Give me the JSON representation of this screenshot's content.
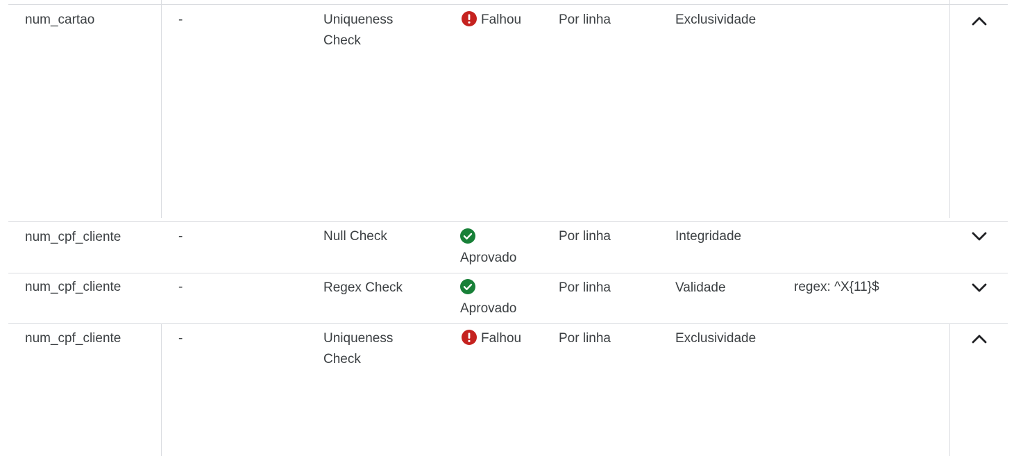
{
  "rows": [
    {
      "column": "num_cartao",
      "dimension_value": "-",
      "rule": "Uniqueness Check",
      "status": "Falhou",
      "status_type": "failed",
      "scope": "Por linha",
      "dimension": "Exclusividade",
      "params": "",
      "expanded": true,
      "toggle_icon": "chevron-up-icon"
    },
    {
      "column": "num_cpf_cliente",
      "dimension_value": "-",
      "rule": "Null Check",
      "status": "Aprovado",
      "status_type": "passed",
      "scope": "Por linha",
      "dimension": "Integridade",
      "params": "",
      "expanded": false,
      "toggle_icon": "chevron-down-icon"
    },
    {
      "column": "num_cpf_cliente",
      "dimension_value": "-",
      "rule": "Regex Check",
      "status": "Aprovado",
      "status_type": "passed",
      "scope": "Por linha",
      "dimension": "Validade",
      "params": "regex: ^X{11}$",
      "expanded": false,
      "toggle_icon": "chevron-down-icon"
    },
    {
      "column": "num_cpf_cliente",
      "dimension_value": "-",
      "rule": "Uniqueness Check",
      "status": "Falhou",
      "status_type": "failed",
      "scope": "Por linha",
      "dimension": "Exclusividade",
      "params": "",
      "expanded": true,
      "toggle_icon": "chevron-up-icon"
    }
  ],
  "colors": {
    "failed": "#c5221f",
    "passed": "#188038",
    "divider": "#dadce0",
    "text": "#3c4043"
  }
}
